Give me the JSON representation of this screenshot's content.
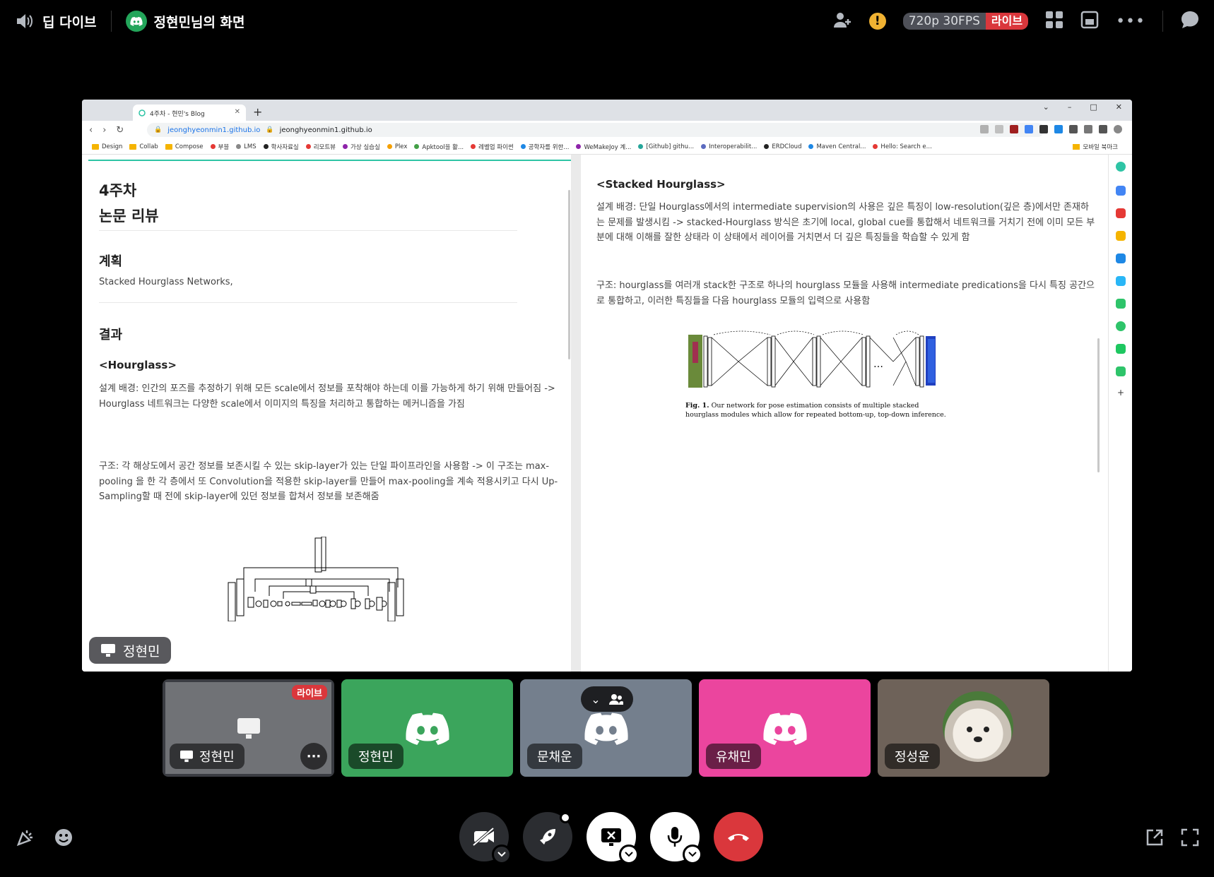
{
  "topbar": {
    "channel_name": "딥 다이브",
    "stream_title": "정현민님의 화면",
    "quality": "720p 30FPS",
    "live": "라이브"
  },
  "browser": {
    "tab_title": "4주차 - 현민's Blog",
    "url_link": "jeonghyeonmin1.github.io",
    "url": "jeonghyeonmin1.github.io",
    "bookmarks": [
      {
        "label": "Design",
        "color": "#f5b400",
        "folder": true
      },
      {
        "label": "Collab",
        "color": "#f5b400",
        "folder": true
      },
      {
        "label": "Compose",
        "color": "#f5b400",
        "folder": true
      },
      {
        "label": "부블",
        "color": "#e53935"
      },
      {
        "label": "LMS",
        "color": "#888888"
      },
      {
        "label": "학사자료실",
        "color": "#222222"
      },
      {
        "label": "리모트뷰",
        "color": "#e53935"
      },
      {
        "label": "가상 실습실",
        "color": "#8e24aa"
      },
      {
        "label": "Plex",
        "color": "#f5a000"
      },
      {
        "label": "Apktool을 활...",
        "color": "#43a047"
      },
      {
        "label": "레벨업 파이썬",
        "color": "#e53935"
      },
      {
        "label": "공학자를 위한...",
        "color": "#1e88e5"
      },
      {
        "label": "WeMakeJoy 계...",
        "color": "#8e24aa"
      },
      {
        "label": "[Github] githu...",
        "color": "#26a69a"
      },
      {
        "label": "Interoperabilit...",
        "color": "#5c6bc0"
      },
      {
        "label": "ERDCloud",
        "color": "#222222"
      },
      {
        "label": "Maven Central...",
        "color": "#1e88e5"
      },
      {
        "label": "Hello: Search e...",
        "color": "#e53935"
      }
    ],
    "mobile_bookmarks": "모바일 북마크"
  },
  "doc_left": {
    "title_line1": "4주차",
    "title_line2": "논문 리뷰",
    "plan_heading": "계획",
    "plan_text": "Stacked Hourglass Networks,",
    "result_heading": "결과",
    "hourglass_heading": "<Hourglass>",
    "background_text": "설계 배경: 인간의 포즈를 추정하기 위해 모든 scale에서 정보를 포착해야 하는데 이를 가능하게 하기 위해 만들어짐 -> Hourglass 네트워크는 다양한 scale에서 이미지의 특징을 처리하고 통합하는 메커니즘을 가짐",
    "structure_text": "구조: 각 해상도에서 공간 정보를 보존시킬 수 있는 skip-layer가 있는 단일 파이프라인을 사용함 -> 이 구조는 max-pooling 을 한 각 층에서 또 Convolution을 적용한 skip-layer를 만들어 max-pooling을 계속 적용시키고 다시 Up-Sampling할 때 전에 skip-layer에 있던 정보를 합쳐서 정보를 보존해줌"
  },
  "doc_right": {
    "heading": "<Stacked Hourglass>",
    "background_text": "설계 배경: 단일 Hourglass에서의 intermediate supervision의 사용은 깊은 특징이 low-resolution(깊은 층)에서만 존재하는 문제를 발생시킴 -> stacked-Hourglass 방식은 초기에 local, global cue를 통합해서 네트워크를 거치기 전에 이미 모든 부분에 대해 이해를 잘한 상태라 이 상태에서 레이어를 거치면서 더 깊은 특징들을 학습할 수 있게 함",
    "structure_text": "구조: hourglass를 여러개 stack한 구조로 하나의 hourglass 모듈을 사용해 intermediate predications을 다시 특징 공간으로 통합하고, 이러한 특징들을 다음 hourglass 모듈의 입력으로 사용함",
    "fig_label": "Fig. 1.",
    "fig_caption": "Our network for pose estimation consists of multiple stacked hourglass modules which allow for repeated bottom-up, top-down inference."
  },
  "stream_badge": "정현민",
  "participants": [
    {
      "name": "정현민",
      "color": "#3a3c42",
      "live": "라이브",
      "screen": true
    },
    {
      "name": "정현민",
      "color": "#3ba55c"
    },
    {
      "name": "문채운",
      "color": "#747f8d"
    },
    {
      "name": "유채민",
      "color": "#eb459e"
    },
    {
      "name": "정성윤",
      "color": "#6e6259"
    }
  ],
  "icons": {
    "speaker": "speaker-icon",
    "discord": "discord-icon",
    "add_friend": "add-friend-icon",
    "warning": "warning-icon",
    "grid": "grid-icon",
    "popout": "popout-icon",
    "more": "more-icon",
    "chat": "chat-icon"
  }
}
